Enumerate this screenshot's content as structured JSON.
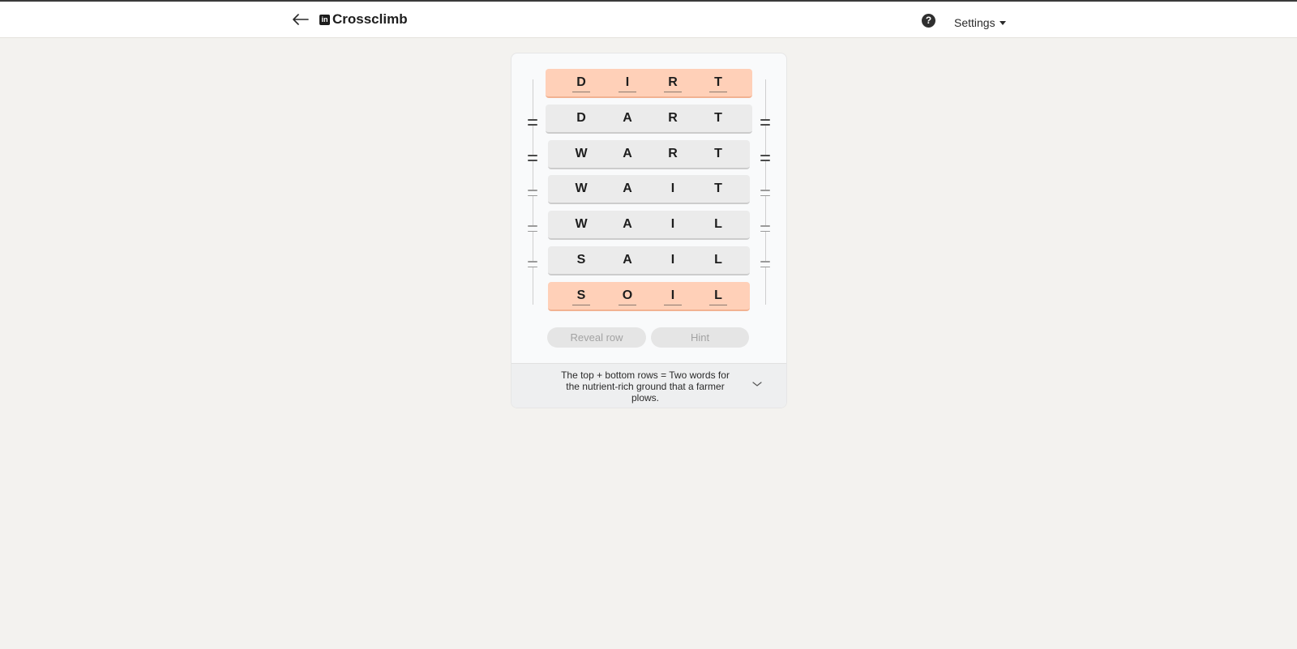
{
  "header": {
    "title": "Crossclimb",
    "logo_text": "in",
    "help_symbol": "?",
    "settings_label": "Settings"
  },
  "board": {
    "rows": [
      {
        "letters": [
          "D",
          "I",
          "R",
          "T"
        ],
        "type": "end"
      },
      {
        "letters": [
          "D",
          "A",
          "R",
          "T"
        ],
        "type": "middle"
      },
      {
        "letters": [
          "W",
          "A",
          "R",
          "T"
        ],
        "type": "middle"
      },
      {
        "letters": [
          "W",
          "A",
          "I",
          "T"
        ],
        "type": "middle"
      },
      {
        "letters": [
          "W",
          "A",
          "I",
          "L"
        ],
        "type": "middle"
      },
      {
        "letters": [
          "S",
          "A",
          "I",
          "L"
        ],
        "type": "middle"
      },
      {
        "letters": [
          "S",
          "O",
          "I",
          "L"
        ],
        "type": "end"
      }
    ]
  },
  "actions": {
    "reveal_label": "Reveal row",
    "hint_label": "Hint"
  },
  "clue": {
    "text": "The top + bottom rows = Two words for the nutrient-rich ground that a farmer plows."
  },
  "colors": {
    "end_row": "#ffd0b8",
    "middle_row": "#ebebeb",
    "background": "#f3f2ef"
  }
}
